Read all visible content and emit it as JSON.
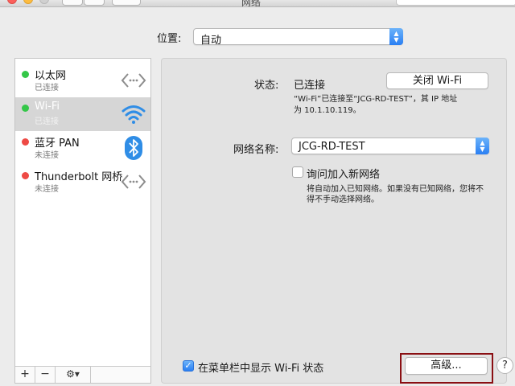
{
  "window": {
    "title": "网络"
  },
  "location": {
    "label": "位置:",
    "value": "自动"
  },
  "services": [
    {
      "name": "以太网",
      "status": "已连接",
      "dot": "green",
      "icon": "ethernet-arrows-icon"
    },
    {
      "name": "Wi-Fi",
      "status": "已连接",
      "dot": "green",
      "icon": "wifi-icon",
      "selected": true
    },
    {
      "name": "蓝牙 PAN",
      "status": "未连接",
      "dot": "red",
      "icon": "bluetooth-icon"
    },
    {
      "name": "Thunderbolt 网桥",
      "status": "未连接",
      "dot": "red",
      "icon": "ethernet-arrows-icon"
    }
  ],
  "sidebar_toolbar": {
    "add": "+",
    "remove": "−",
    "gear": "⚙▾"
  },
  "detail": {
    "status_label": "状态:",
    "status_value": "已连接",
    "toggle_wifi_button": "关闭 Wi-Fi",
    "status_desc_line1": "“Wi-Fi”已连接至“JCG-RD-TEST”，其 IP 地址",
    "status_desc_line2": "为 10.1.10.119。",
    "network_name_label": "网络名称:",
    "network_name_value": "JCG-RD-TEST",
    "ask_join_label": "询问加入新网络",
    "ask_join_checked": false,
    "ask_join_desc_line1": "将自动加入已知网络。如果没有已知网络，您将不",
    "ask_join_desc_line2": "得不手动选择网络。",
    "show_in_menubar_label": "在菜单栏中显示 Wi-Fi 状态",
    "show_in_menubar_checked": true,
    "advanced_button": "高级...",
    "help": "?"
  },
  "colors": {
    "status_connected": "#34c748",
    "status_disconnected": "#ee4a45",
    "accent_blue": "#2a7ff3",
    "highlight_box": "#8a0f13"
  }
}
